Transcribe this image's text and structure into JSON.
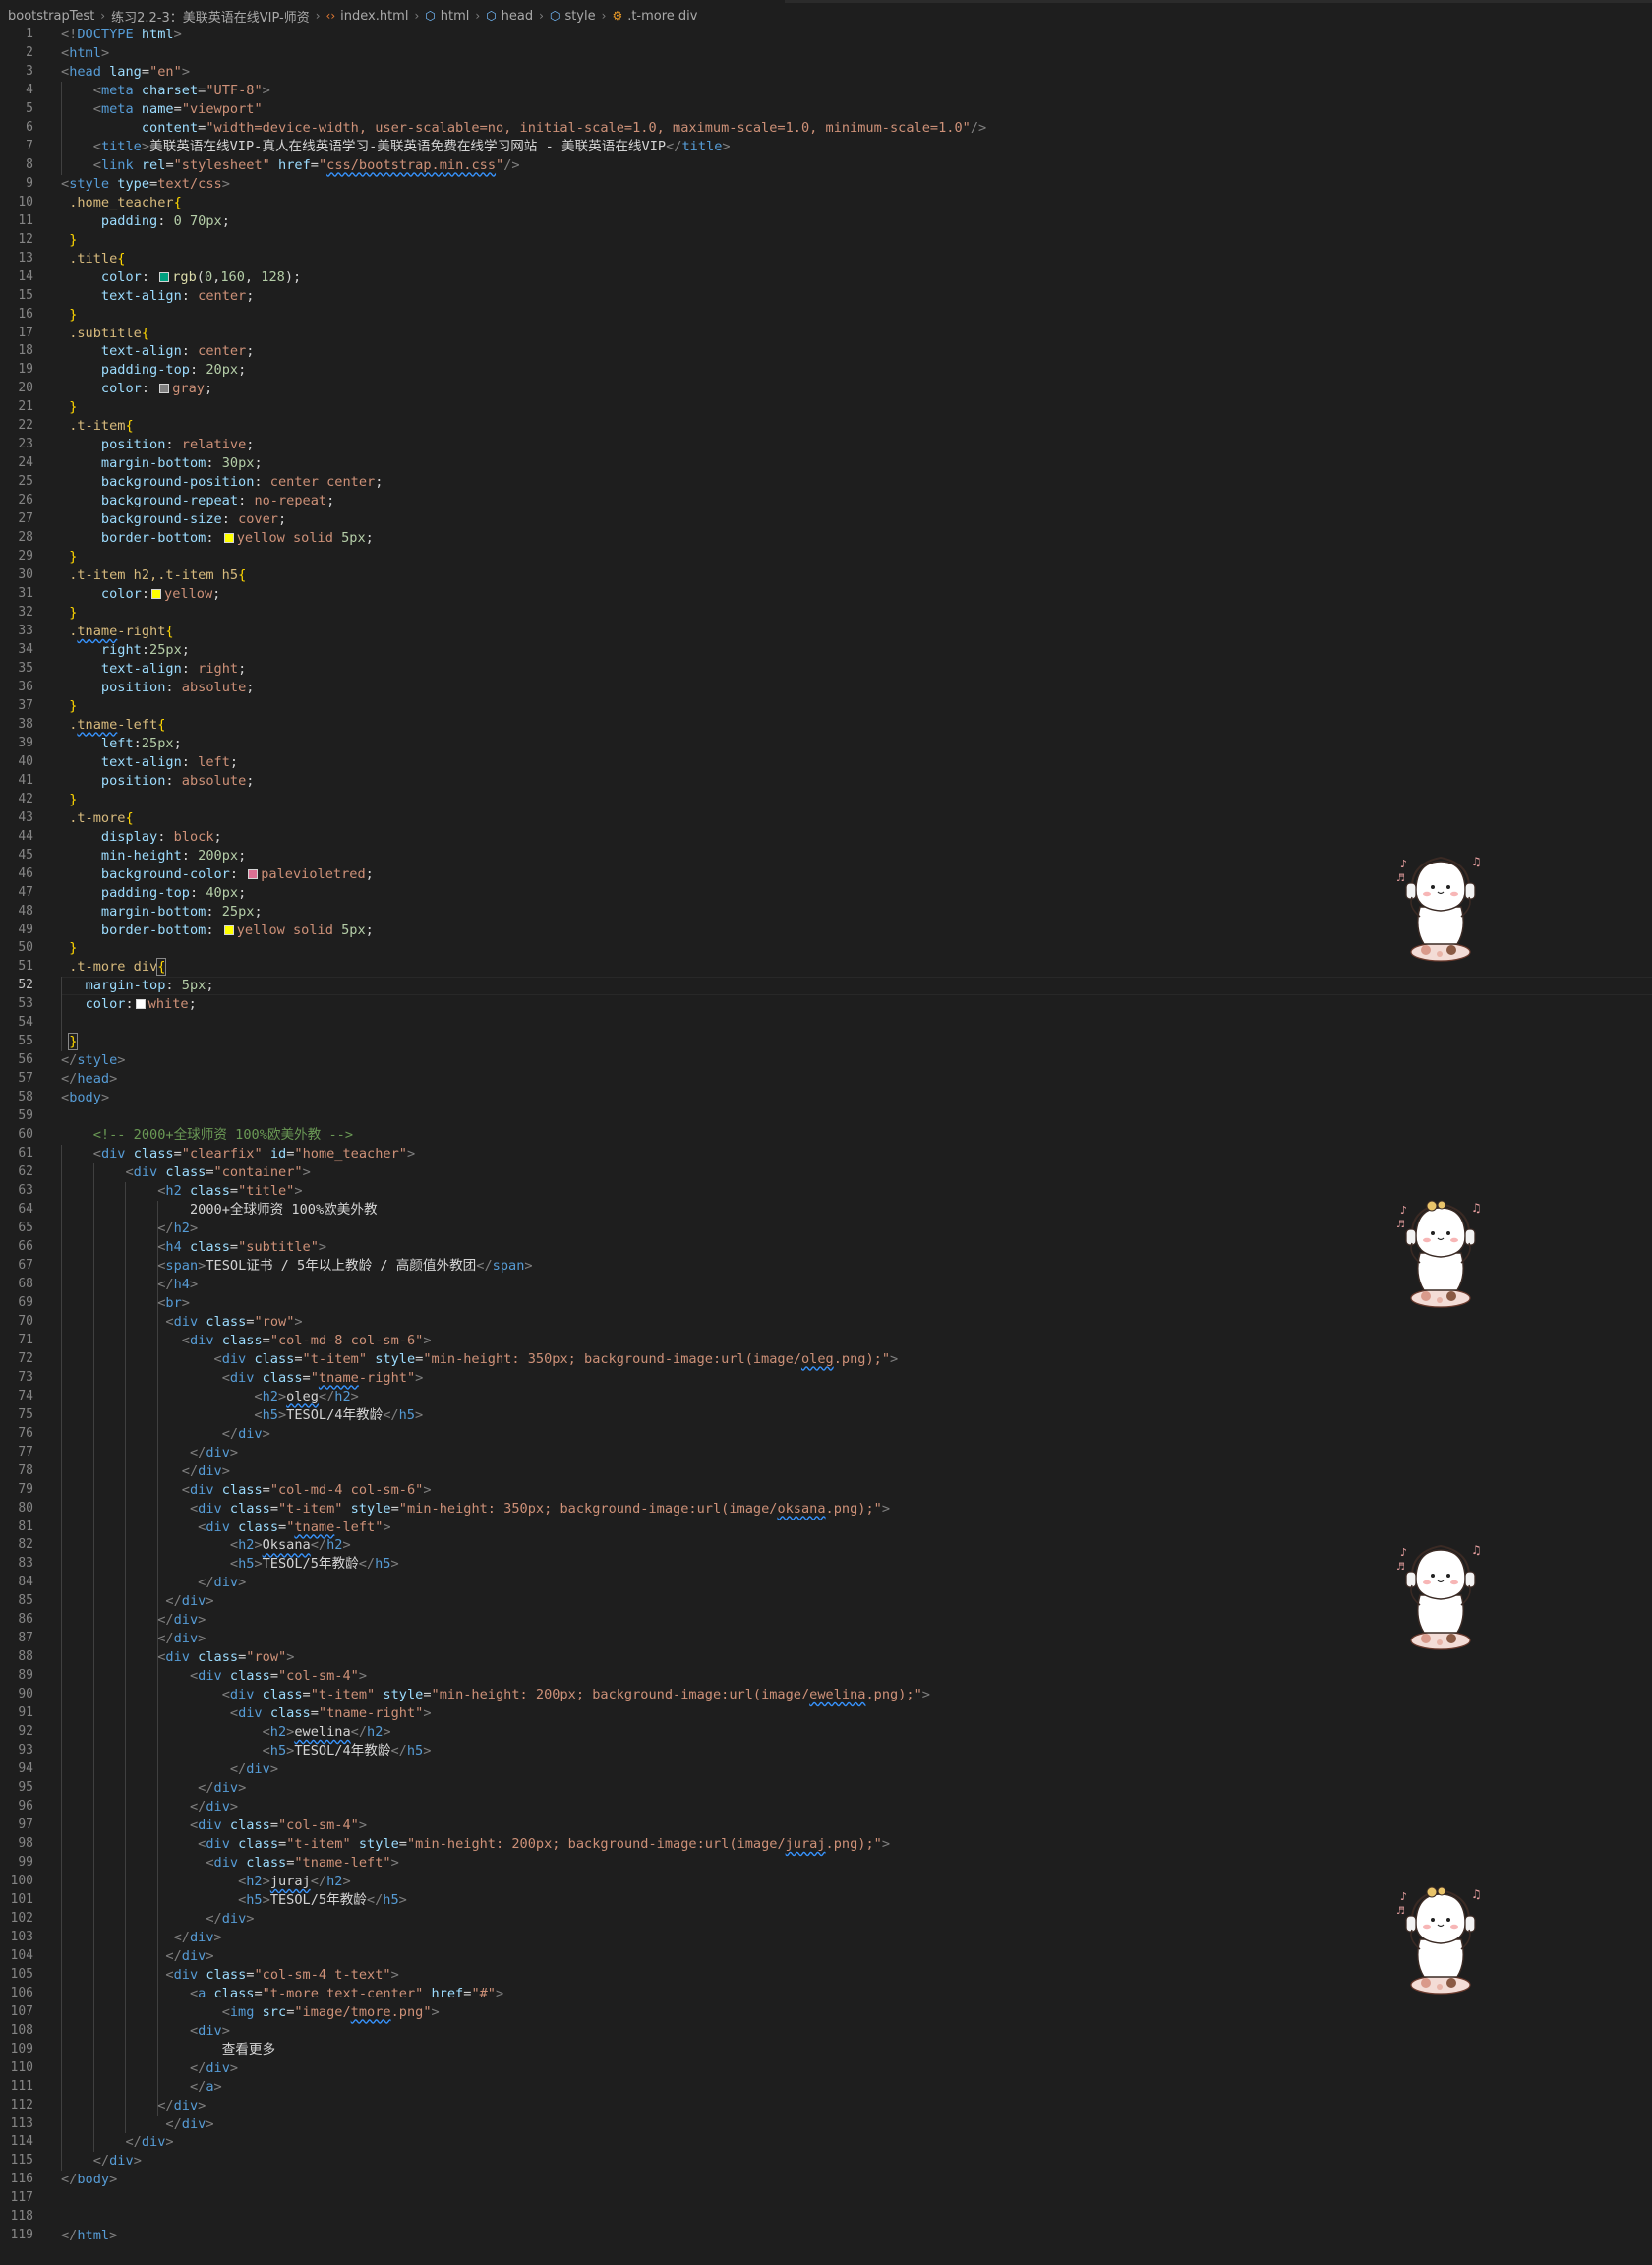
{
  "breadcrumb": {
    "items": [
      "bootstrapTest",
      "练习2.2-3：美联英语在线VIP-师资",
      "index.html",
      "html",
      "head",
      "style",
      ".t-more div"
    ]
  },
  "colors": {
    "background": "#1e1e1e",
    "tag": "#569cd6",
    "attribute": "#9cdcfe",
    "string": "#ce9178",
    "selector": "#d7ba7d",
    "number": "#b5cea8",
    "comment": "#6a9955",
    "swatch_teal": "#00a080",
    "swatch_gray": "#808080",
    "swatch_yellow": "#ffff00",
    "swatch_pvr": "#db7093",
    "swatch_white": "#ffffff"
  },
  "editor": {
    "current_line": 52,
    "line_count": 119,
    "sticker_name": "headphone-bunny-sticker"
  }
}
